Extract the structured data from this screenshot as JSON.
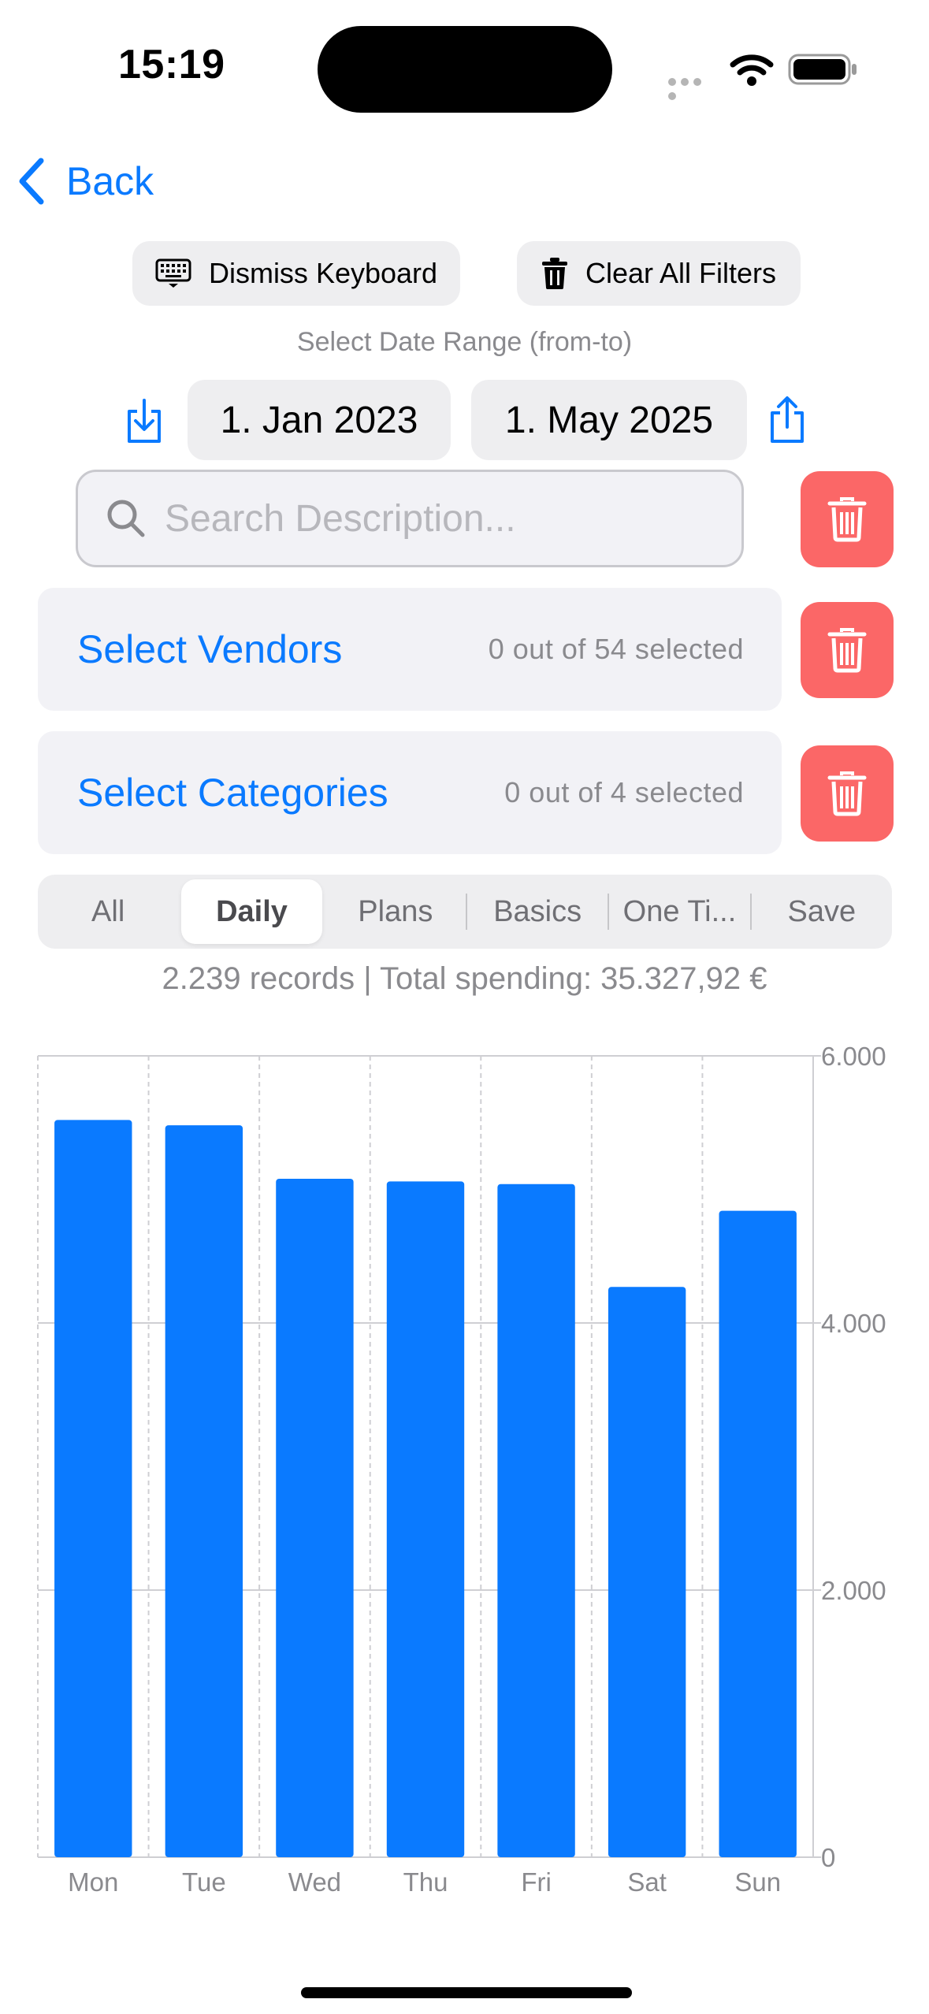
{
  "status_bar": {
    "time": "15:19"
  },
  "nav": {
    "back_label": "Back"
  },
  "toolbar": {
    "dismiss_keyboard_label": "Dismiss Keyboard",
    "clear_filters_label": "Clear All Filters"
  },
  "date_range": {
    "label": "Select Date Range (from-to)",
    "from": "1. Jan 2023",
    "to": "1. May 2025"
  },
  "search": {
    "placeholder": "Search Description...",
    "value": ""
  },
  "vendors": {
    "label": "Select Vendors",
    "count": "0 out of 54 selected"
  },
  "categories": {
    "label": "Select Categories",
    "count": "0 out of 4 selected"
  },
  "segments": [
    {
      "label": "All",
      "active": false
    },
    {
      "label": "Daily",
      "active": true
    },
    {
      "label": "Plans",
      "active": false
    },
    {
      "label": "Basics",
      "active": false
    },
    {
      "label": "One Ti...",
      "active": false
    },
    {
      "label": "Save",
      "active": false
    }
  ],
  "summary": "2.239 records | Total spending: 35.327,92 €",
  "colors": {
    "accent": "#0a7aff",
    "danger": "#fb6767",
    "bar": "#0a7aff"
  },
  "icons": {
    "back": "chevron-left-icon",
    "keyboard": "keyboard-icon",
    "trash": "trash-icon",
    "import": "download-icon",
    "export": "share-icon",
    "search": "magnifier-icon"
  },
  "chart_data": {
    "type": "bar",
    "categories": [
      "Mon",
      "Tue",
      "Wed",
      "Thu",
      "Fri",
      "Sat",
      "Sun"
    ],
    "values": [
      5520,
      5480,
      5080,
      5060,
      5040,
      4270,
      4840
    ],
    "y_ticks": [
      "0",
      "2.000",
      "4.000",
      "6.000"
    ],
    "y_tick_values": [
      0,
      2000,
      4000,
      6000
    ],
    "ylim": [
      0,
      6000
    ],
    "grid": true,
    "y_axis_side": "right"
  }
}
